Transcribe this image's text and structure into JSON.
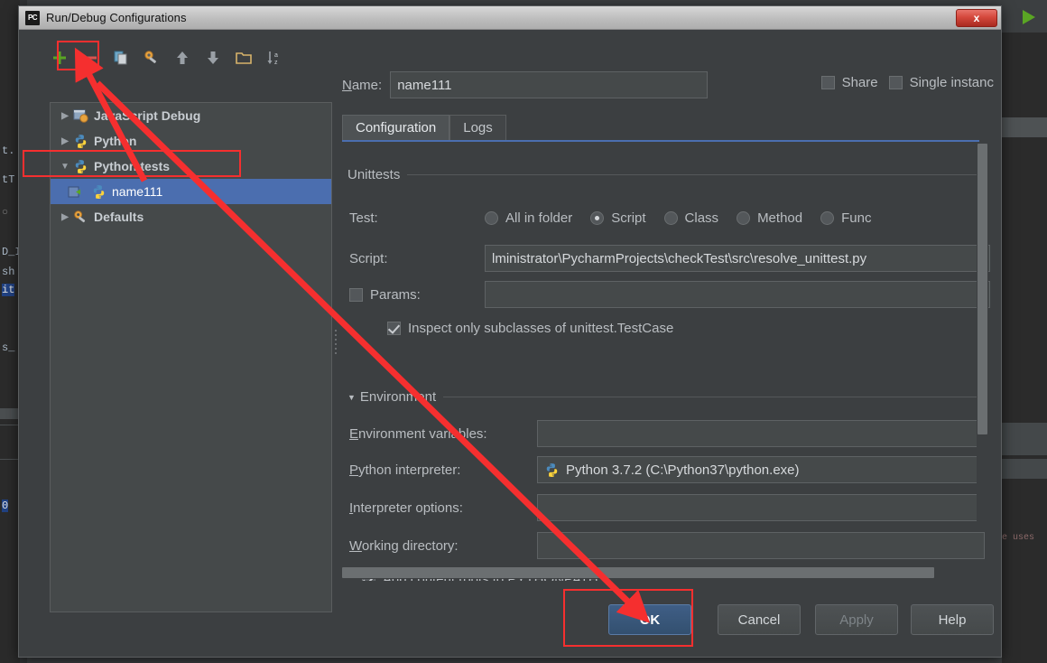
{
  "window": {
    "title": "Run/Debug Configurations",
    "app_icon": "pycharm-icon",
    "app_icon_text": "PC",
    "close_label": "x"
  },
  "toolbar": {
    "items": [
      {
        "name": "add-configuration",
        "icon": "plus-icon",
        "glyph": "+"
      },
      {
        "name": "remove-configuration",
        "icon": "minus-icon",
        "glyph": "–"
      },
      {
        "name": "copy-configuration",
        "icon": "copy-icon",
        "glyph": "❐"
      },
      {
        "name": "edit-templates",
        "icon": "wrench-icon",
        "glyph": "🔧"
      },
      {
        "name": "move-up",
        "icon": "arrow-up-icon",
        "glyph": "↑"
      },
      {
        "name": "move-down",
        "icon": "arrow-down-icon",
        "glyph": "↓"
      },
      {
        "name": "create-folder",
        "icon": "folder-icon",
        "glyph": "📁"
      },
      {
        "name": "sort-alphabetically",
        "icon": "sort-az-icon",
        "glyph": "↓"
      }
    ]
  },
  "tree": {
    "items": [
      {
        "label": "JavaScript Debug",
        "expanded": false,
        "icon": "javascript-debug-icon",
        "selected": false,
        "child": false
      },
      {
        "label": "Python",
        "expanded": false,
        "icon": "python-icon",
        "selected": false,
        "child": false
      },
      {
        "label": "Python tests",
        "expanded": true,
        "icon": "python-icon",
        "selected": false,
        "child": false
      },
      {
        "label": "name111",
        "expanded": null,
        "icon": "python-icon",
        "selected": true,
        "child": true
      },
      {
        "label": "Defaults",
        "expanded": false,
        "icon": "wrench-icon",
        "selected": false,
        "child": false
      }
    ]
  },
  "form": {
    "name_label": "Name:",
    "name_value": "name111",
    "share_label": "Share",
    "share_checked": false,
    "single_instance_label": "Single instanc",
    "single_instance_checked": false,
    "tabs": [
      {
        "label": "Configuration",
        "active": true
      },
      {
        "label": "Logs",
        "active": false
      }
    ],
    "unittests": {
      "group_title": "Unittests",
      "test_label": "Test:",
      "test_options": [
        {
          "label": "All in folder",
          "selected": false
        },
        {
          "label": "Script",
          "selected": true
        },
        {
          "label": "Class",
          "selected": false
        },
        {
          "label": "Method",
          "selected": false
        },
        {
          "label": "Func",
          "selected": false
        }
      ],
      "script_label": "Script:",
      "script_value": "lministrator\\PycharmProjects\\checkTest\\src\\resolve_unittest.py",
      "params_label": "Params:",
      "params_checked": false,
      "params_value": "",
      "inspect_label": "Inspect only subclasses of unittest.TestCase",
      "inspect_checked": true
    },
    "environment": {
      "section_title": "Environment",
      "expanded": true,
      "env_vars_label": "Environment variables:",
      "env_vars_value": "",
      "interpreter_label": "Python interpreter:",
      "interpreter_value": "Python 3.7.2 (C:\\Python37\\python.exe)",
      "interpreter_icon": "python-icon",
      "interpreter_options_label": "Interpreter options:",
      "interpreter_options_value": "",
      "working_dir_label": "Working directory:",
      "working_dir_value": "",
      "pythonpath_label": "Add content roots to PYTHONPATH",
      "pythonpath_checked": true
    }
  },
  "buttons": {
    "ok": "OK",
    "cancel": "Cancel",
    "apply": "Apply",
    "apply_disabled": true,
    "help": "Help"
  },
  "annotations": {
    "color": "#f52f2f",
    "boxes": [
      {
        "name": "remove-button-highlight"
      },
      {
        "name": "selected-config-highlight"
      },
      {
        "name": "ok-button-highlight"
      }
    ],
    "arrows": [
      {
        "name": "arrow-to-remove-button"
      },
      {
        "name": "arrow-to-ok-button"
      }
    ]
  },
  "background": {
    "left_fragments": [
      "t.",
      "tT",
      "○",
      "D_I",
      "sh",
      "it",
      "s_",
      "0"
    ],
    "right_text": "e uses",
    "run_icon": "run-play-icon"
  }
}
